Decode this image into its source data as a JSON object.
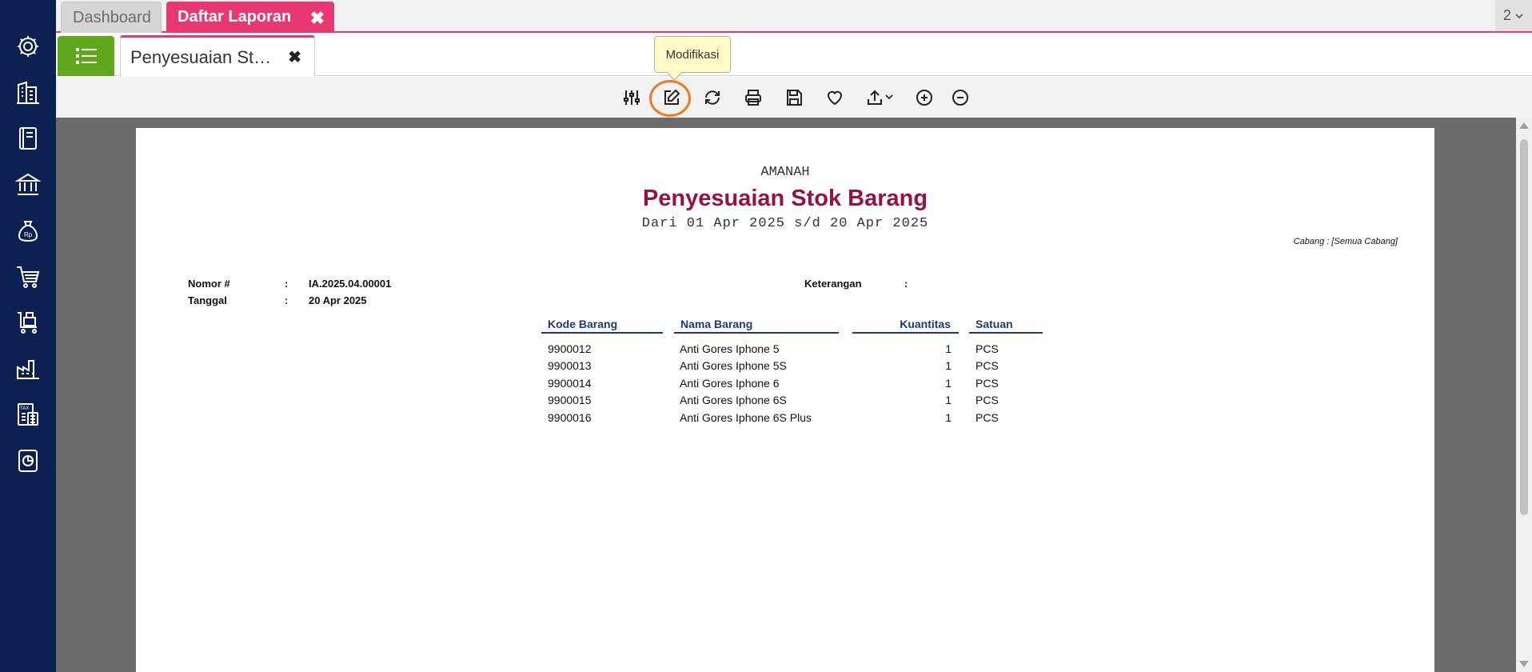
{
  "sidebar": {
    "icons": [
      "gear-icon",
      "building-icon",
      "book-icon",
      "bank-icon",
      "money-bag-icon",
      "cart-icon",
      "cart-box-icon",
      "factory-icon",
      "tax-icon",
      "report-chart-icon"
    ]
  },
  "top_tabs": [
    {
      "label": "Dashboard"
    },
    {
      "label": "Daftar Laporan",
      "close": "✖"
    }
  ],
  "pager": {
    "value": "2"
  },
  "doc_tab": {
    "label": "Penyesuaian Stok Barang",
    "close": "✖"
  },
  "tooltip": {
    "text": "Modifikasi"
  },
  "toolbar": {
    "buttons": [
      "filter-sliders-icon",
      "edit-icon",
      "refresh-icon",
      "print-icon",
      "save-icon",
      "favorite-heart-icon",
      "export-icon",
      "zoom-in-icon",
      "zoom-out-icon"
    ]
  },
  "report": {
    "company": "AMANAH",
    "title": "Penyesuaian Stok Barang",
    "period": "Dari 01 Apr 2025 s/d 20 Apr 2025",
    "branch": "Cabang : [Semua Cabang]",
    "nomor_label": "Nomor #",
    "nomor_sep": ":",
    "nomor_value": "IA.2025.04.00001",
    "tanggal_label": "Tanggal",
    "tanggal_sep": ":",
    "tanggal_value": "20 Apr 2025",
    "keterangan_label": "Keterangan",
    "keterangan_sep": ":",
    "columns": [
      "Kode Barang",
      "Nama Barang",
      "Kuantitas",
      "Satuan"
    ],
    "rows": [
      {
        "kode": "9900012",
        "nama": "Anti Gores Iphone 5",
        "qty": "1",
        "satuan": "PCS"
      },
      {
        "kode": "9900013",
        "nama": "Anti Gores Iphone 5S",
        "qty": "1",
        "satuan": "PCS"
      },
      {
        "kode": "9900014",
        "nama": "Anti Gores Iphone 6",
        "qty": "1",
        "satuan": "PCS"
      },
      {
        "kode": "9900015",
        "nama": "Anti Gores Iphone 6S",
        "qty": "1",
        "satuan": "PCS"
      },
      {
        "kode": "9900016",
        "nama": "Anti Gores Iphone 6S Plus",
        "qty": "1",
        "satuan": "PCS"
      }
    ]
  },
  "colors": {
    "sidebar": "#0d2052",
    "accent": "#e8386f",
    "list_button": "#5fa81c",
    "title": "#97123f",
    "column_header": "#1f3a6e",
    "highlight": "#f07a20"
  }
}
